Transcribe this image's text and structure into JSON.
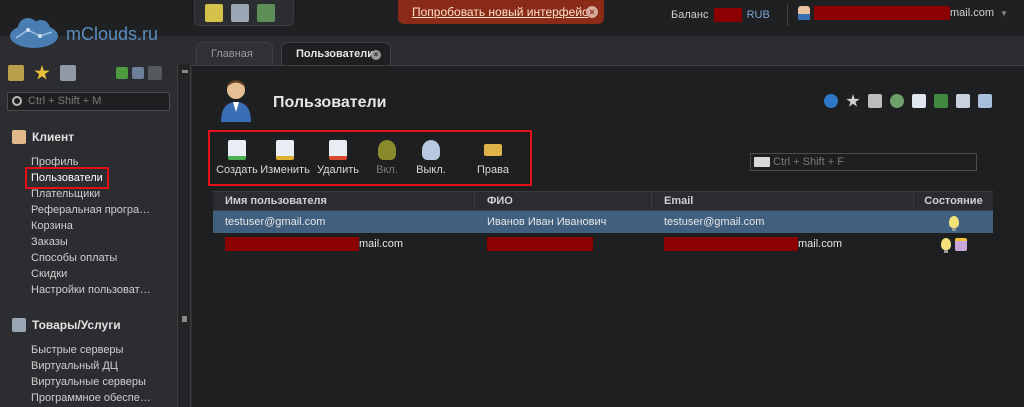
{
  "brand": {
    "name": "mClouds.ru"
  },
  "top": {
    "try_new": "Попробовать новый интерфейс",
    "balance_label": "Баланс",
    "balance_currency": "RUB",
    "user_email_suffix": "mail.com"
  },
  "sidebar": {
    "search_placeholder": "Ctrl + Shift + M",
    "client_title": "Клиент",
    "client_items": [
      "Профиль",
      "Пользователи",
      "Плательщики",
      "Реферальная програ…",
      "Корзина",
      "Заказы",
      "Способы оплаты",
      "Скидки",
      "Настройки пользоват…"
    ],
    "goods_title": "Товары/Услуги",
    "goods_items": [
      "Быстрые серверы",
      "Виртуальный ДЦ",
      "Виртуальные серверы",
      "Программное обеспе…"
    ]
  },
  "tabs": {
    "main": "Главная",
    "users": "Пользователи"
  },
  "page": {
    "title": "Пользователи"
  },
  "toolbar": {
    "create": "Создать",
    "edit": "Изменить",
    "delete": "Удалить",
    "enable": "Вкл.",
    "disable": "Выкл.",
    "rights": "Права"
  },
  "filter": {
    "placeholder": "Ctrl + Shift + F"
  },
  "table": {
    "headers": [
      "Имя пользователя",
      "ФИО",
      "Email",
      "Состояние"
    ],
    "rows": [
      {
        "username": "testuser@gmail.com",
        "fio": "Иванов Иван Иванович",
        "email": "testuser@gmail.com"
      },
      {
        "username_suffix": "mail.com",
        "email_suffix": "mail.com"
      }
    ]
  },
  "colors": {
    "accent_red": "#e3101a",
    "selected_row": "#41607f",
    "brand_blue": "#5a8cbf"
  }
}
